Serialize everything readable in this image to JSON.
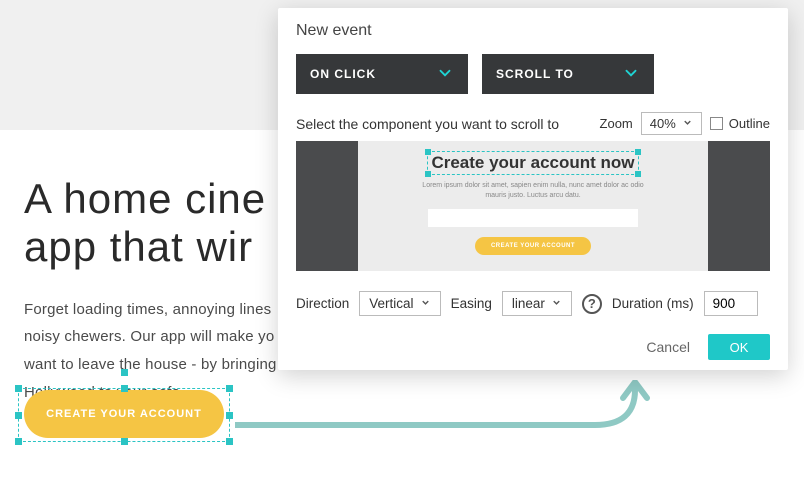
{
  "hero": {
    "title_line1": "A home cine",
    "title_line2": "app that wir",
    "body_line1": "Forget loading times, annoying lines",
    "body_line2": "noisy chewers.  Our app will make yo",
    "body_line3": "want to leave the house - by bringing",
    "body_line4": "Hollywood to your sofa.",
    "cta_label": "CREATE YOUR ACCOUNT"
  },
  "modal": {
    "title": "New event",
    "trigger_label": "ON CLICK",
    "action_label": "SCROLL TO",
    "instruction": "Select the component you want to scroll to",
    "zoom": {
      "label": "Zoom",
      "value": "40%"
    },
    "outline_label": "Outline",
    "preview": {
      "title": "Create your account now",
      "lorem": "Lorem ipsum dolor sit amet, sapien enim nulla, nunc amet dolor ac odio mauris justo. Luctus arcu datu.",
      "btn": "CREATE YOUR ACCOUNT"
    },
    "params": {
      "direction_label": "Direction",
      "direction_value": "Vertical",
      "easing_label": "Easing",
      "easing_value": "linear",
      "duration_label": "Duration (ms)",
      "duration_value": "900"
    },
    "cancel": "Cancel",
    "ok": "OK"
  },
  "colors": {
    "accent": "#1fc8c8",
    "cta": "#f5c544"
  }
}
